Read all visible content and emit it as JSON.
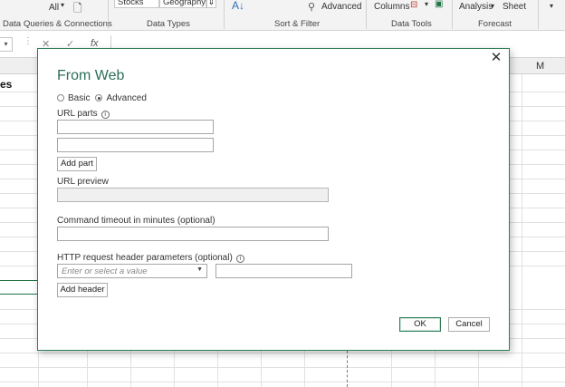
{
  "ribbon": {
    "all_label": "All",
    "stocks_label": "Stocks",
    "geography_label": "Geography",
    "advanced_label": "Advanced",
    "columns_label": "Columns",
    "analysis_label": "Analysis",
    "sheet_label": "Sheet",
    "groups": {
      "data": "Data",
      "queries": "Queries & Connections",
      "data_types": "Data Types",
      "sort_filter": "Sort & Filter",
      "data_tools": "Data Tools",
      "forecast": "Forecast"
    }
  },
  "formula_bar": {
    "cancel_symbol": "✕",
    "enter_symbol": "✓",
    "fx_symbol": "fx"
  },
  "grid": {
    "column_m": "M",
    "cell_fragment": "es"
  },
  "dialog": {
    "title": "From Web",
    "mode_options": [
      {
        "label": "Basic",
        "selected": false
      },
      {
        "label": "Advanced",
        "selected": true
      }
    ],
    "url_parts_label": "URL parts",
    "url_parts": [
      "",
      ""
    ],
    "add_part_label": "Add part",
    "url_preview_label": "URL preview",
    "url_preview_value": "",
    "timeout_label": "Command timeout in minutes (optional)",
    "timeout_value": "",
    "headers_label": "HTTP request header parameters (optional)",
    "header_name_placeholder": "Enter or select a value",
    "header_value": "",
    "add_header_label": "Add header",
    "ok_label": "OK",
    "cancel_label": "Cancel",
    "close_symbol": "✕",
    "info_symbol": "i"
  },
  "colors": {
    "accent": "#2e7d59",
    "title": "#2e6f58"
  }
}
